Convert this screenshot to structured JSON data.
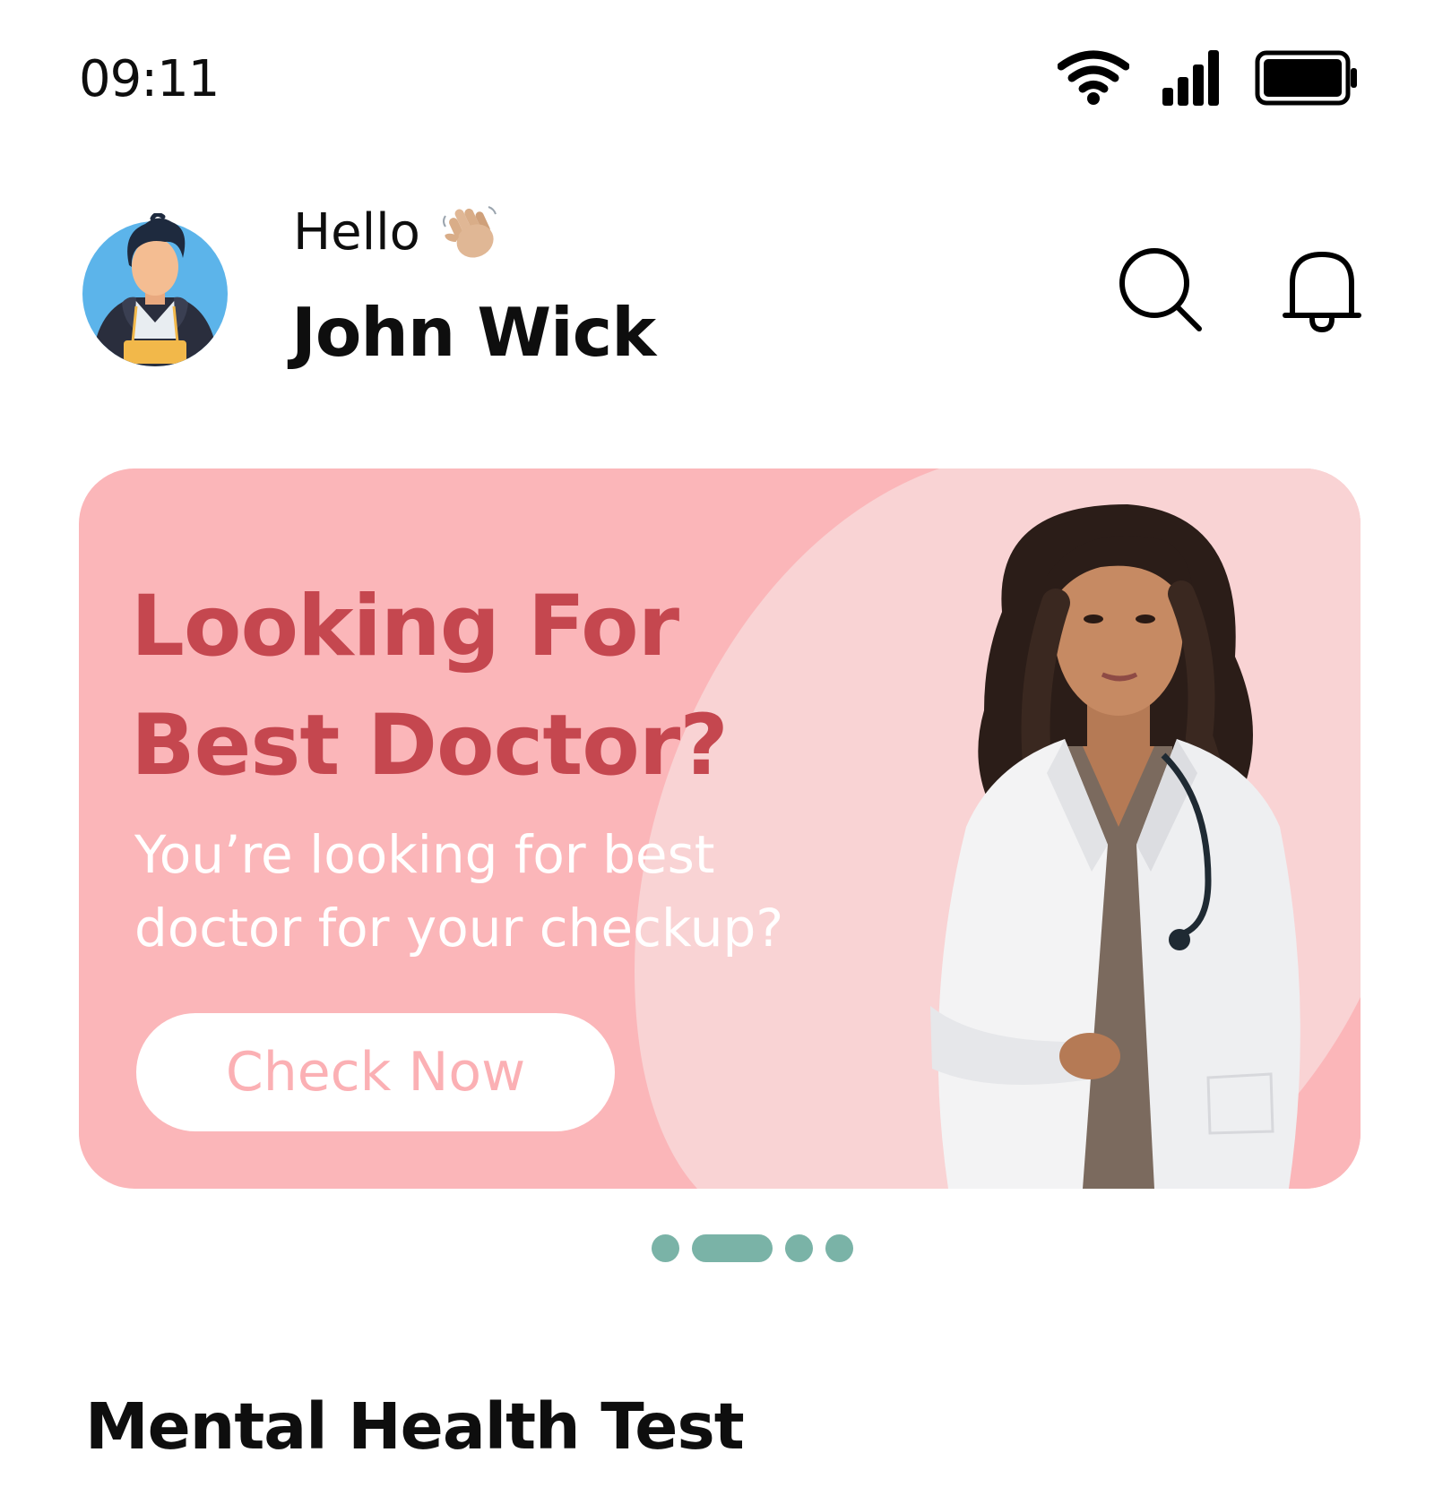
{
  "status_bar": {
    "time": "09:11",
    "icons": [
      "wifi-icon",
      "signal-icon",
      "battery-icon"
    ]
  },
  "header": {
    "greeting": "Hello",
    "greeting_icon": "waving-hand-icon",
    "user_name": "John Wick",
    "actions": [
      "search-icon",
      "bell-icon"
    ]
  },
  "banner": {
    "title": "Looking For Best Doctor?",
    "subtitle": "You’re looking for best doctor for your checkup?",
    "button_label": "Check Now",
    "image": "doctor-photo",
    "colors": {
      "background": "#fbb6b9",
      "accent": "#f9d3d4",
      "title": "#c5474f",
      "button_text": "#fbb0b4"
    }
  },
  "carousel": {
    "slide_count": 4,
    "active_index": 1,
    "color": "#7ab3a7"
  },
  "section": {
    "title": "Mental Health Test"
  }
}
